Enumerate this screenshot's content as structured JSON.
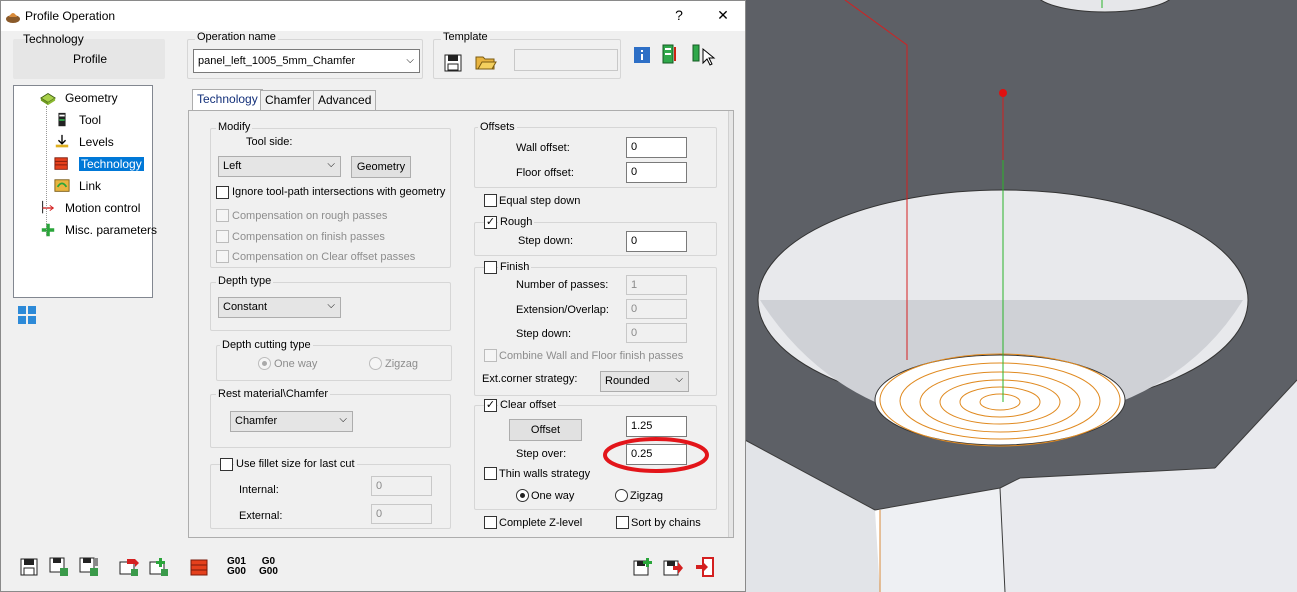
{
  "dialog": {
    "title": "Profile Operation",
    "help": "?",
    "close": "✕"
  },
  "technology_box": {
    "label": "Technology",
    "value": "Profile"
  },
  "operation_name": {
    "label": "Operation name",
    "value": "panel_left_1005_5mm_Chamfer"
  },
  "template": {
    "label": "Template"
  },
  "tree": {
    "items": [
      {
        "label": "Geometry",
        "icon": "geometry-icon"
      },
      {
        "label": "Tool",
        "icon": "tool-icon"
      },
      {
        "label": "Levels",
        "icon": "levels-icon"
      },
      {
        "label": "Technology",
        "icon": "technology-icon",
        "selected": true
      },
      {
        "label": "Link",
        "icon": "link-icon"
      },
      {
        "label": "Motion control",
        "icon": "motion-control-icon"
      },
      {
        "label": "Misc. parameters",
        "icon": "misc-parameters-icon"
      }
    ]
  },
  "tabs": [
    "Technology",
    "Chamfer",
    "Advanced"
  ],
  "modify": {
    "label": "Modify",
    "tool_side_label": "Tool side:",
    "tool_side_value": "Left",
    "geometry_button": "Geometry",
    "ignore_intersections": "Ignore tool-path intersections with geometry",
    "comp_rough": "Compensation on rough passes",
    "comp_finish": "Compensation on finish passes",
    "comp_clear": "Compensation on Clear offset passes"
  },
  "depth_type": {
    "label": "Depth type",
    "value": "Constant"
  },
  "depth_cutting": {
    "label": "Depth cutting type",
    "one_way": "One way",
    "zigzag": "Zigzag"
  },
  "rest_material": {
    "label": "Rest material\\Chamfer",
    "value": "Chamfer"
  },
  "fillet": {
    "label": "Use fillet size for last cut",
    "internal_label": "Internal:",
    "internal_value": "0",
    "external_label": "External:",
    "external_value": "0"
  },
  "offsets": {
    "label": "Offsets",
    "wall_label": "Wall offset:",
    "wall_value": "0",
    "floor_label": "Floor offset:",
    "floor_value": "0"
  },
  "equal_step_down": "Equal step down",
  "rough": {
    "label": "Rough",
    "step_label": "Step down:",
    "step_value": "0"
  },
  "finish": {
    "label": "Finish",
    "passes_label": "Number of passes:",
    "passes_value": "1",
    "ext_label": "Extension/Overlap:",
    "ext_value": "0",
    "step_label": "Step down:",
    "step_value": "0",
    "combine": "Combine Wall and Floor finish passes"
  },
  "ext_corner": {
    "label": "Ext.corner strategy:",
    "value": "Rounded"
  },
  "clear_offset": {
    "label": "Clear offset",
    "offset_button": "Offset",
    "offset_value": "1.25",
    "step_over_label": "Step over:",
    "step_over_value": "0.25",
    "thin_walls": "Thin walls strategy",
    "one_way": "One way",
    "zigzag": "Zigzag"
  },
  "complete_z": "Complete Z-level",
  "sort_chains": "Sort by chains",
  "bottom": {
    "g01": "G01",
    "g00": "G00",
    "g0": "G0",
    "g00b": "G00"
  },
  "colors": {
    "accent": "#0078d7",
    "highlight": "#e3151a"
  }
}
